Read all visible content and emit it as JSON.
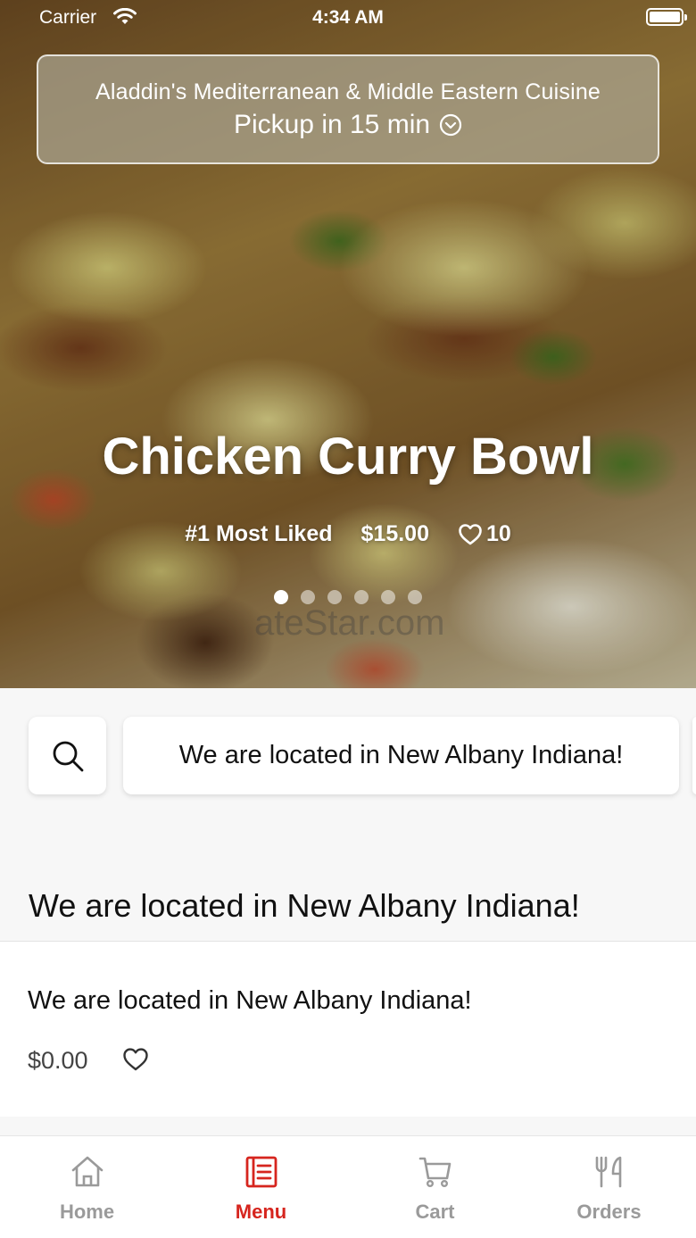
{
  "status_bar": {
    "carrier": "Carrier",
    "time": "4:34 AM"
  },
  "header": {
    "restaurant_name": "Aladdin's Mediterranean & Middle Eastern Cuisine",
    "pickup_label": "Pickup in 15 min"
  },
  "featured": {
    "title": "Chicken Curry Bowl",
    "rank": "#1 Most Liked",
    "price": "$15.00",
    "likes": "10",
    "slide_count": 6,
    "active_slide": 1,
    "watermark": "ateStar.com"
  },
  "search": {
    "icon": "search-icon"
  },
  "categories": [
    "We are located in New Albany Indiana!"
  ],
  "section": {
    "title": "We are located in New Albany Indiana!"
  },
  "items": [
    {
      "name": "We are located in New Albany Indiana!",
      "price": "$0.00"
    }
  ],
  "tabs": [
    {
      "label": "Home",
      "icon": "home-icon",
      "active": false
    },
    {
      "label": "Menu",
      "icon": "menu-icon",
      "active": true
    },
    {
      "label": "Cart",
      "icon": "cart-icon",
      "active": false
    },
    {
      "label": "Orders",
      "icon": "orders-icon",
      "active": false
    }
  ],
  "colors": {
    "accent": "#d6251e",
    "inactive_tab": "#9a9a9a"
  }
}
